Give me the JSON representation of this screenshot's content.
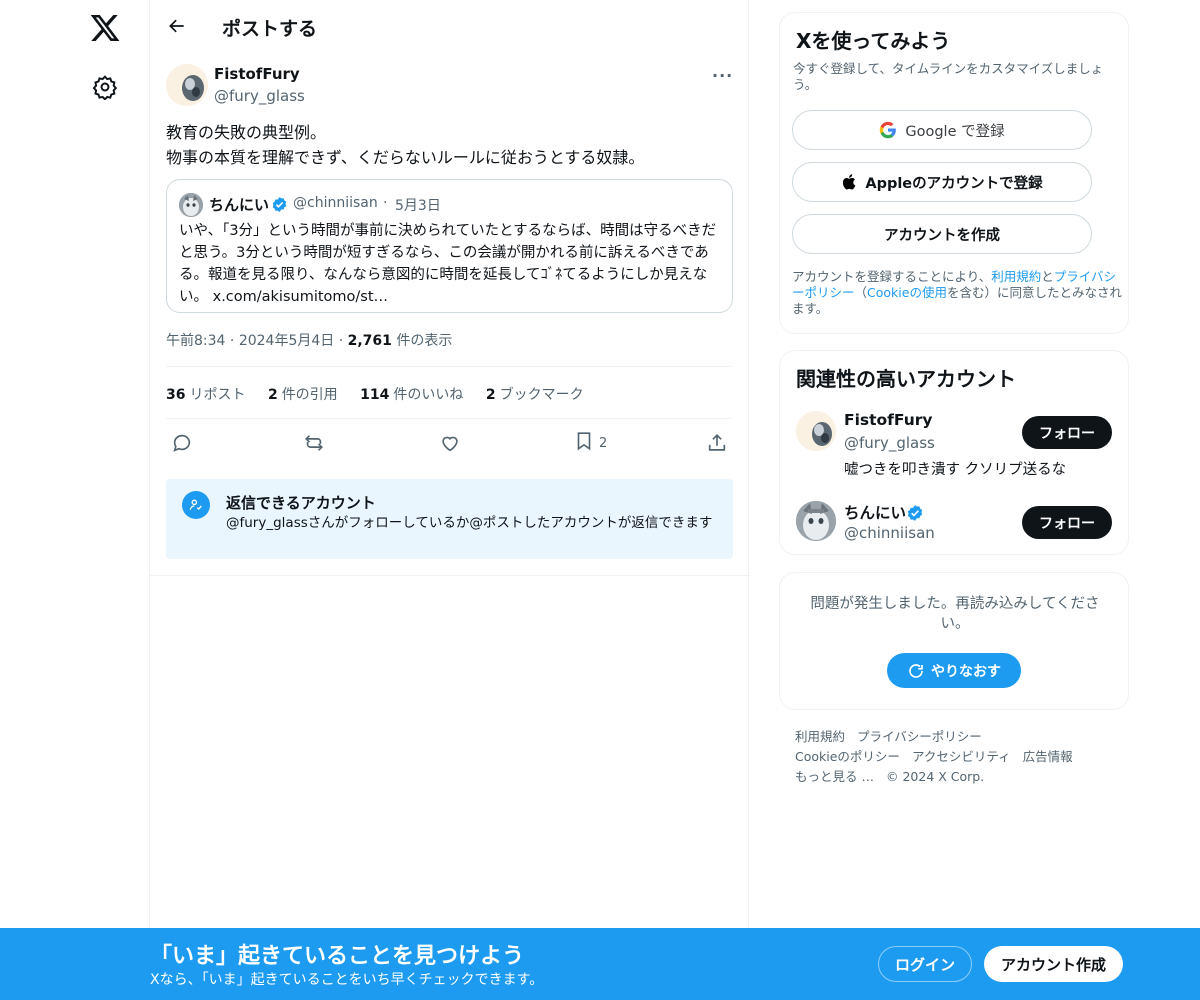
{
  "nav": {
    "logo_icon": "x-logo-icon",
    "settings_icon": "gear-icon"
  },
  "header": {
    "back_icon": "arrow-left-icon",
    "title": "ポストする"
  },
  "post": {
    "author_name": "FistofFury",
    "author_handle": "@fury_glass",
    "more_label": "···",
    "text_line1": "教育の失敗の典型例。",
    "text_line2": "物事の本質を理解できず、くだらないルールに従おうとする奴隷。",
    "quote": {
      "name": "ちんにい",
      "handle": "@chinniisan",
      "separator": "·",
      "date": "5月3日",
      "text": "いや、「3分」という時間が事前に決められていたとするならば、時間は守るべきだと思う。3分という時間が短すぎるなら、この会議が開かれる前に訴えるべきである。報道を見る限り、なんなら意図的に時間を延長してｺﾞﾈてるようにしか見えない。 x.com/akisumitomo/st…"
    },
    "time": "午前8:34",
    "dot": "·",
    "date": "2024年5月4日",
    "views_count": "2,761",
    "views_label": "件の表示",
    "stats": [
      {
        "count": "36",
        "label": "リポスト"
      },
      {
        "count": "2",
        "label": "件の引用"
      },
      {
        "count": "114",
        "label": "件のいいね"
      },
      {
        "count": "2",
        "label": "ブックマーク"
      }
    ],
    "bookmark_count": "2",
    "reply_restriction": {
      "title": "返信できるアカウント",
      "text": "@fury_glassさんがフォローしているか@ポストしたアカウントが返信できます"
    }
  },
  "signup": {
    "title": "Xを使ってみよう",
    "subtitle": "今すぐ登録して、タイムラインをカスタマイズしましょう。",
    "google_label": "Google で登録",
    "apple_label": "Appleのアカウントで登録",
    "create_label": "アカウントを作成",
    "terms_pre": "アカウントを登録することにより、",
    "terms_link1": "利用規約",
    "terms_and": "と",
    "terms_link2": "プライバシーポリシー",
    "terms_paren_open": "（",
    "terms_link3": "Cookieの使用",
    "terms_post": "を含む）に同意したとみなされます。"
  },
  "related": {
    "title": "関連性の高いアカウント",
    "accounts": [
      {
        "name": "FistofFury",
        "handle": "@fury_glass",
        "bio": "嘘つきを叩き潰す クソリプ送るな",
        "follow_label": "フォロー"
      },
      {
        "name": "ちんにい",
        "handle": "@chinniisan",
        "bio": "",
        "follow_label": "フォロー"
      }
    ]
  },
  "trends_error": {
    "message": "問題が発生しました。再読み込みしてください。",
    "retry_label": "やりなおす"
  },
  "footer": {
    "links": [
      "利用規約",
      "プライバシーポリシー",
      "Cookieのポリシー",
      "アクセシビリティ",
      "広告情報",
      "もっと見る …",
      "© 2024 X Corp."
    ]
  },
  "banner": {
    "title": "「いま」起きていることを見つけよう",
    "subtitle": "Xなら、「いま」起きていることをいち早くチェックできます。",
    "login_label": "ログイン",
    "signup_label": "アカウント作成"
  },
  "colors": {
    "accent": "#1d9bf0",
    "text": "#0f1419",
    "muted": "#536471",
    "border": "#eff3f4"
  }
}
